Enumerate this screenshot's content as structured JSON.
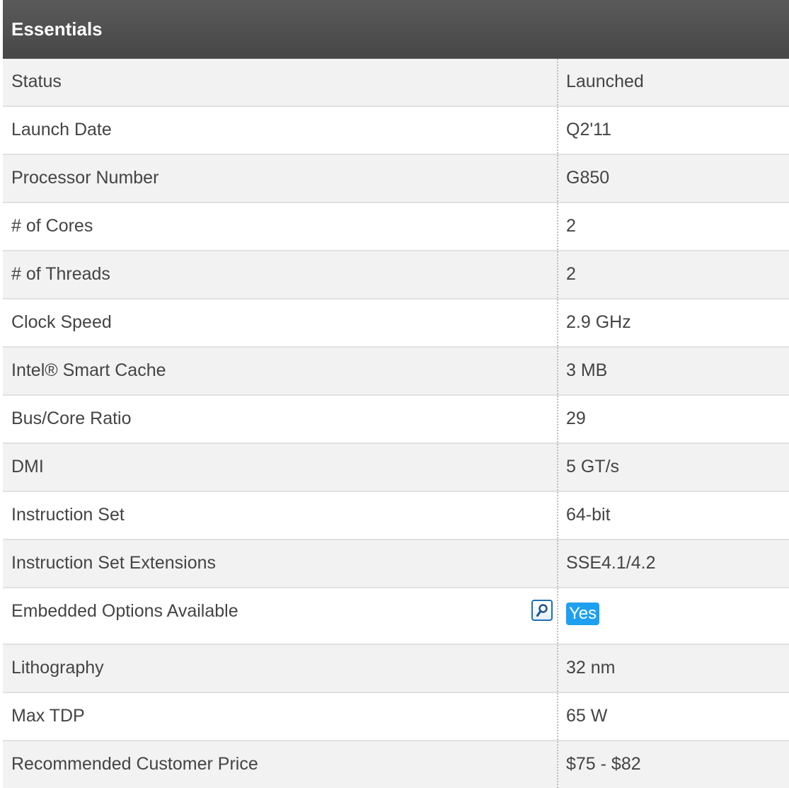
{
  "section": {
    "title": "Essentials"
  },
  "rows": [
    {
      "label": "Status",
      "value": "Launched"
    },
    {
      "label": "Launch Date",
      "value": "Q2'11"
    },
    {
      "label": "Processor Number",
      "value": "G850"
    },
    {
      "label": "# of Cores",
      "value": "2"
    },
    {
      "label": "# of Threads",
      "value": "2"
    },
    {
      "label": "Clock Speed",
      "value": "2.9 GHz"
    },
    {
      "label": "Intel® Smart Cache",
      "value": "3 MB"
    },
    {
      "label": "Bus/Core Ratio",
      "value": "29"
    },
    {
      "label": "DMI",
      "value": "5 GT/s"
    },
    {
      "label": "Instruction Set",
      "value": "64-bit"
    },
    {
      "label": "Instruction Set Extensions",
      "value": "SSE4.1/4.2"
    },
    {
      "label": "Embedded Options Available",
      "value": "Yes",
      "icon": "magnifier-icon"
    },
    {
      "label": "Lithography",
      "value": "32 nm"
    },
    {
      "label": "Max TDP",
      "value": "65 W"
    },
    {
      "label": "Recommended Customer Price",
      "value": "$75 - $82"
    }
  ],
  "colors": {
    "header_bg": "#4f4f4f",
    "row_alt_bg": "#f2f2f2",
    "badge_bg": "#1ea0f0",
    "icon_border": "#1f6fb5"
  }
}
